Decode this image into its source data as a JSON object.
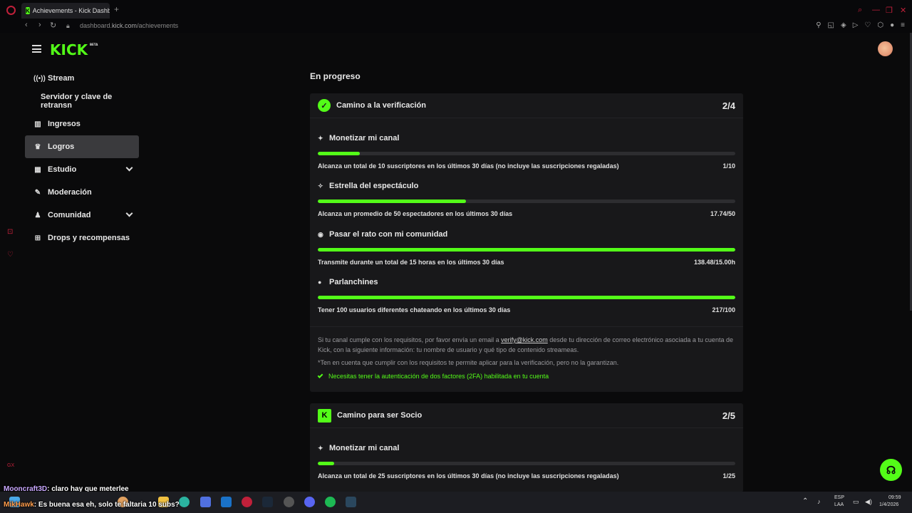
{
  "browser": {
    "tab_title": "Achievements - Kick Dashb",
    "tab_favicon": "K",
    "new_tab": "+",
    "url_prefix": "dashboard.",
    "url_domain": "kick.com",
    "url_path": "/achievements"
  },
  "header": {
    "logo": "KICK",
    "logo_badge": "BETA"
  },
  "sidebar": {
    "items": [
      {
        "label": "Stream",
        "icon": "broadcast-icon",
        "glyph": "((•))"
      },
      {
        "label": "Servidor y clave de retransn",
        "icon": "",
        "glyph": ""
      },
      {
        "label": "Ingresos",
        "icon": "chart-icon",
        "glyph": "▥"
      },
      {
        "label": "Logros",
        "icon": "trophy-icon",
        "glyph": "🏆"
      },
      {
        "label": "Estudio",
        "icon": "studio-icon",
        "glyph": "▦"
      },
      {
        "label": "Moderación",
        "icon": "wrench-icon",
        "glyph": "🔧"
      },
      {
        "label": "Comunidad",
        "icon": "community-icon",
        "glyph": "♟"
      },
      {
        "label": "Drops y recompensas",
        "icon": "gift-icon",
        "glyph": "⊞"
      }
    ]
  },
  "main": {
    "section_title": "En progreso",
    "card1": {
      "title": "Camino a la verificación",
      "count": "2/4",
      "achievements": [
        {
          "title": "Monetizar mi canal",
          "icon": "sparkle-icon",
          "glyph": "✦",
          "desc": "Alcanza un total de 10 suscriptores en los últimos 30 días (no incluye las suscripciones regaladas)",
          "value": "1/10",
          "progress": 0.1
        },
        {
          "title": "Estrella del espectáculo",
          "icon": "star-person-icon",
          "glyph": "✧",
          "desc": "Alcanza un promedio de 50 espectadores en los últimos 30 días",
          "value": "17.74/50",
          "progress": 0.355
        },
        {
          "title": "Pasar el rato con mi comunidad",
          "icon": "broadcast-icon",
          "glyph": "◉",
          "desc": "Transmite durante un total de 15 horas en los últimos 30 días",
          "value": "138.48/15.00h",
          "progress": 1.0
        },
        {
          "title": "Parlanchines",
          "icon": "chat-bubble-icon",
          "glyph": "💬",
          "desc": "Tener 100 usuarios diferentes chateando en los últimos 30 días",
          "value": "217/100",
          "progress": 1.0
        }
      ],
      "info_line1_before": "Si tu canal cumple con los requisitos, por favor envía un email a ",
      "info_email": "verify@kick.com",
      "info_line1_after": " desde tu dirección de correo electrónico asociada a tu cuenta de Kick, con la siguiente información: tu nombre de usuario y qué tipo de contenido streameas.",
      "info_note": "*Ten en cuenta que cumplir con los requisitos te permite aplicar para la verificación, pero no la garantizan.",
      "requirement": "Necesitas tener la autenticación de dos factores (2FA) habilitada en tu cuenta"
    },
    "card2": {
      "title": "Camino para ser Socio",
      "count": "2/5",
      "achievements": [
        {
          "title": "Monetizar mi canal",
          "icon": "sparkle-icon",
          "glyph": "✦",
          "desc": "Alcanza un total de 25 suscriptores en los últimos 30 días (no incluye las suscripciones regaladas)",
          "value": "1/25",
          "progress": 0.04
        }
      ]
    }
  },
  "chat": [
    {
      "user": "Mooncraft3D",
      "message": ": claro hay que meterlee"
    },
    {
      "user": "MikHawk",
      "message": ": Es buena esa eh, solo te faltaria 10 subs?"
    }
  ],
  "taskbar": {
    "lang1": "ESP",
    "lang2": "LAA",
    "time": "09:59",
    "date": "1/4/2026",
    "overlay": "GX"
  },
  "colors": {
    "accent": "#53fc18",
    "background": "#0a0a0b",
    "card": "#18181a"
  }
}
